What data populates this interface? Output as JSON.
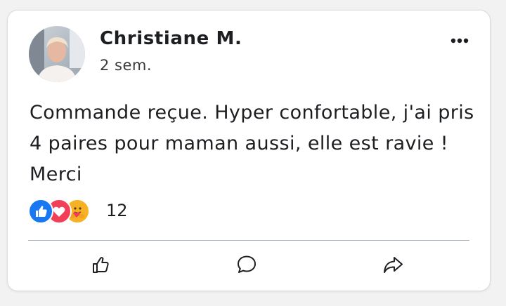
{
  "post": {
    "author": "Christiane M.",
    "time": "2 sem.",
    "message": "Commande reçue. Hyper confortable, j'ai pris 4 paires pour maman aussi, elle est ravie ! Merci"
  },
  "reactions": {
    "types": [
      "like-icon",
      "love-icon",
      "care-icon"
    ],
    "count": "12"
  },
  "actions": [
    "like-icon",
    "comment-icon",
    "share-icon"
  ],
  "colors": {
    "like_blue": "#1877f2",
    "love_red": "#f33e58",
    "care_yellow": "#f7b125",
    "text": "#1c1e21"
  }
}
